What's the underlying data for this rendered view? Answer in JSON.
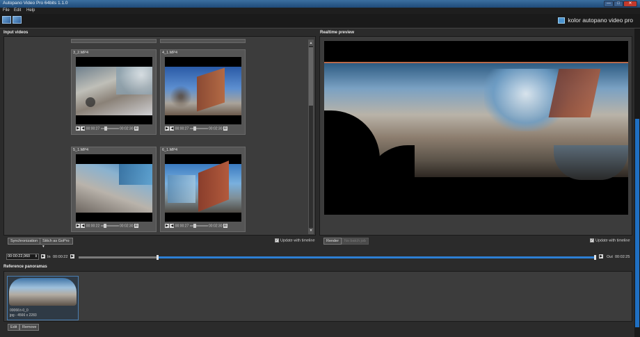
{
  "window": {
    "title": "Autopano Video Pro 64bits 1.1.0",
    "min": "—",
    "max": "□",
    "close": "✕"
  },
  "menu": [
    "File",
    "Edit",
    "Help"
  ],
  "brand": "kolor autopano video pro",
  "input_videos": {
    "title": "Input videos",
    "cards": [
      {
        "label": "3_2.MP4",
        "time_left": "00:00:27",
        "time_right": "00:02:30",
        "position": 0.19
      },
      {
        "label": "4_1.MP4",
        "time_left": "00:00:27",
        "time_right": "00:02:30",
        "position": 0.19
      },
      {
        "label": "5_1.MP4",
        "time_left": "00:00:22",
        "time_right": "00:02:30",
        "position": 0.15
      },
      {
        "label": "6_1.MP4",
        "time_left": "00:00:27",
        "time_right": "00:02:30",
        "position": 0.19
      }
    ],
    "sync_button": "Synchronization",
    "stitch_label": "Stitch",
    "stitch_value": "as GoPro",
    "update_timeline": "Update with timeline"
  },
  "realtime_preview": {
    "title": "Realtime preview",
    "render_button": "Render",
    "batch_button": "No batch job",
    "update_timeline": "Update with timeline"
  },
  "timeline": {
    "current": "00:00:22,060",
    "in_label": "In",
    "in_time": "00:00:22",
    "out_label": "Out",
    "out_time": "00:02:25",
    "position": 0.15
  },
  "reference_panoramas": {
    "title": "Reference panoramas",
    "thumb_name": "00066:t-0_0",
    "thumb_meta": "jpg - 4566 x 2283",
    "edit_button": "Edit",
    "remove_button": "Remove"
  },
  "colors": {
    "accent": "#2d7fd4",
    "panel": "#3c3c3c",
    "background": "#2b2b2b"
  }
}
